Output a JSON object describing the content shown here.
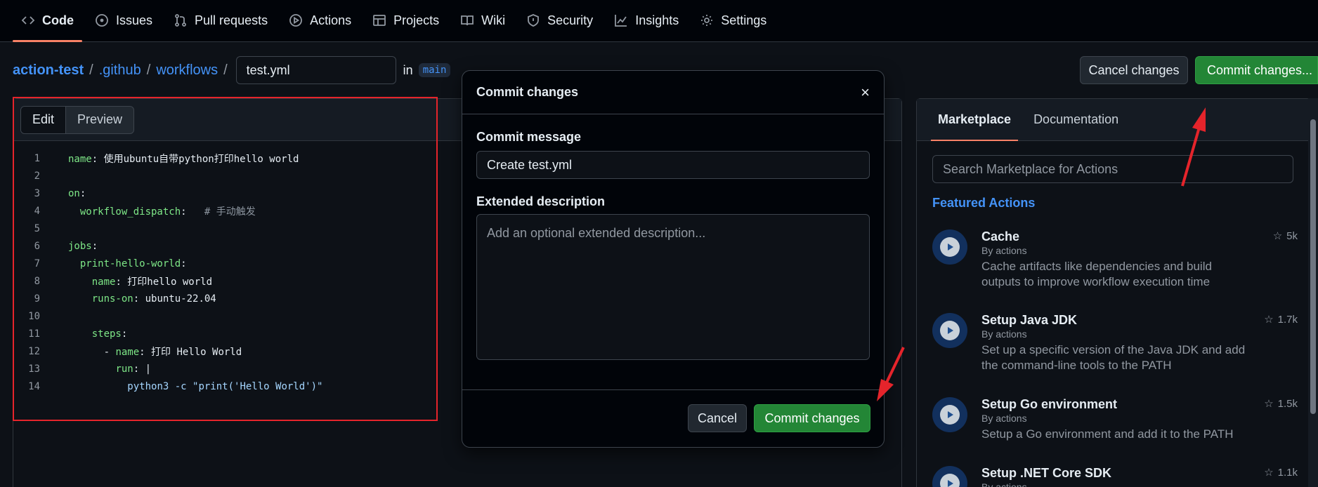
{
  "nav": {
    "tabs": [
      {
        "label": "Code",
        "icon": "code-icon"
      },
      {
        "label": "Issues",
        "icon": "issue-icon"
      },
      {
        "label": "Pull requests",
        "icon": "pull-request-icon"
      },
      {
        "label": "Actions",
        "icon": "play-icon"
      },
      {
        "label": "Projects",
        "icon": "table-icon"
      },
      {
        "label": "Wiki",
        "icon": "book-icon"
      },
      {
        "label": "Security",
        "icon": "shield-icon"
      },
      {
        "label": "Insights",
        "icon": "graph-icon"
      },
      {
        "label": "Settings",
        "icon": "gear-icon"
      }
    ]
  },
  "breadcrumb": {
    "repo": "action-test",
    "sep": "/",
    "dir1": ".github",
    "dir2": "workflows",
    "filename": "test.yml",
    "in": "in",
    "branch": "main"
  },
  "toolbar": {
    "cancel_label": "Cancel changes",
    "commit_label": "Commit changes..."
  },
  "editor": {
    "edit_tab": "Edit",
    "preview_tab": "Preview",
    "lines": [
      "name: 使用ubuntu自带python打印hello world",
      "",
      "on:",
      "  workflow_dispatch:   # 手动触发",
      "",
      "jobs:",
      "  print-hello-world:",
      "    name: 打印hello world",
      "    runs-on: ubuntu-22.04",
      "",
      "    steps:",
      "      - name: 打印 Hello World",
      "        run: |",
      "          python3 -c \"print('Hello World')\""
    ]
  },
  "sidebar": {
    "tab_marketplace": "Marketplace",
    "tab_docs": "Documentation",
    "search_placeholder": "Search Marketplace for Actions",
    "featured_heading": "Featured Actions",
    "actions": [
      {
        "title": "Cache",
        "by": "By actions",
        "desc": "Cache artifacts like dependencies and build outputs to improve workflow execution time",
        "stars": "5k"
      },
      {
        "title": "Setup Java JDK",
        "by": "By actions",
        "desc": "Set up a specific version of the Java JDK and add the command-line tools to the PATH",
        "stars": "1.7k"
      },
      {
        "title": "Setup Go environment",
        "by": "By actions",
        "desc": "Setup a Go environment and add it to the PATH",
        "stars": "1.5k"
      },
      {
        "title": "Setup .NET Core SDK",
        "by": "By actions",
        "desc": "",
        "stars": "1.1k"
      }
    ]
  },
  "modal": {
    "title": "Commit changes",
    "close": "×",
    "message_label": "Commit message",
    "message_value": "Create test.yml",
    "desc_label": "Extended description",
    "desc_placeholder": "Add an optional extended description...",
    "cancel_label": "Cancel",
    "commit_label": "Commit changes"
  },
  "colors": {
    "accent": "#4493f8",
    "green": "#238636",
    "annotation_red": "#e5242b"
  }
}
